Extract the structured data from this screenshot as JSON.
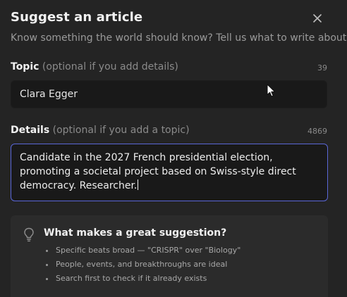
{
  "dialog": {
    "title": "Suggest an article",
    "subtitle": "Know something the world should know? Tell us what to write about.",
    "close_icon": "close-icon"
  },
  "topic": {
    "label": "Topic",
    "hint": "(optional if you add details)",
    "counter": "39",
    "value": "Clara Egger"
  },
  "details": {
    "label": "Details",
    "hint": "(optional if you add a topic)",
    "counter": "4869",
    "value": "Candidate in the 2027 French presidential election, promoting a societal project based on Swiss-style direct democracy. Researcher."
  },
  "tips": {
    "icon": "lightbulb-icon",
    "title": "What makes a great suggestion?",
    "items": [
      "Specific beats broad — \"CRISPR\" over \"Biology\"",
      "People, events, and breakthroughs are ideal",
      "Search first to check if it already exists"
    ]
  },
  "colors": {
    "background": "#242424",
    "input_background": "#191919",
    "focus_border": "#5a67d8",
    "tips_background": "#2b2b2b"
  }
}
